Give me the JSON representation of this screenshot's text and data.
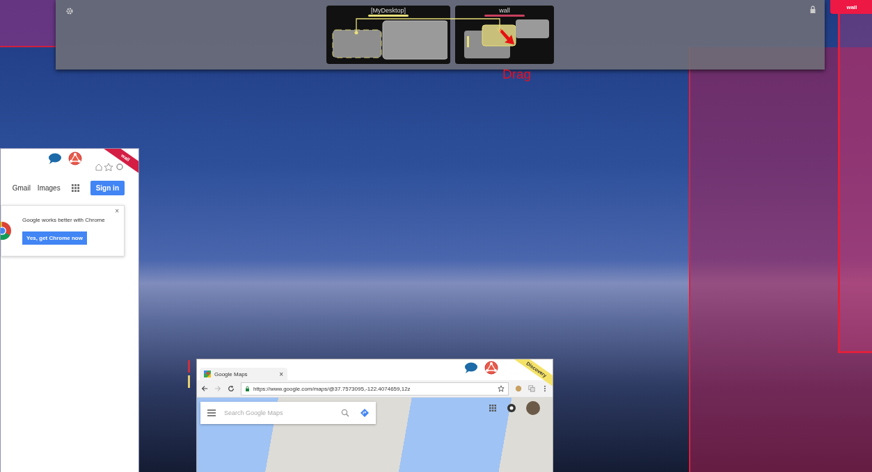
{
  "desktop_switcher": {
    "desktops": [
      {
        "label": "[MyDesktop]",
        "color": "#e8e07a"
      },
      {
        "label": "wall",
        "color": "#c8405e"
      }
    ],
    "drag_hint": "Drag"
  },
  "wall_tab": {
    "label": "wall"
  },
  "left_window": {
    "ribbon": "wall",
    "links": [
      "Gmail",
      "Images"
    ],
    "sign_in": "Sign in",
    "promo": {
      "close": "×",
      "text": "Google works better with Chrome",
      "button": "Yes, get Chrome now"
    }
  },
  "maps_window": {
    "tab": {
      "title": "Google Maps",
      "close": "×"
    },
    "ribbon": "Discovery",
    "url": "https://www.google.com/maps/@37.7573095,-122.4074659,12z",
    "search": {
      "placeholder": "Search Google Maps"
    }
  }
}
